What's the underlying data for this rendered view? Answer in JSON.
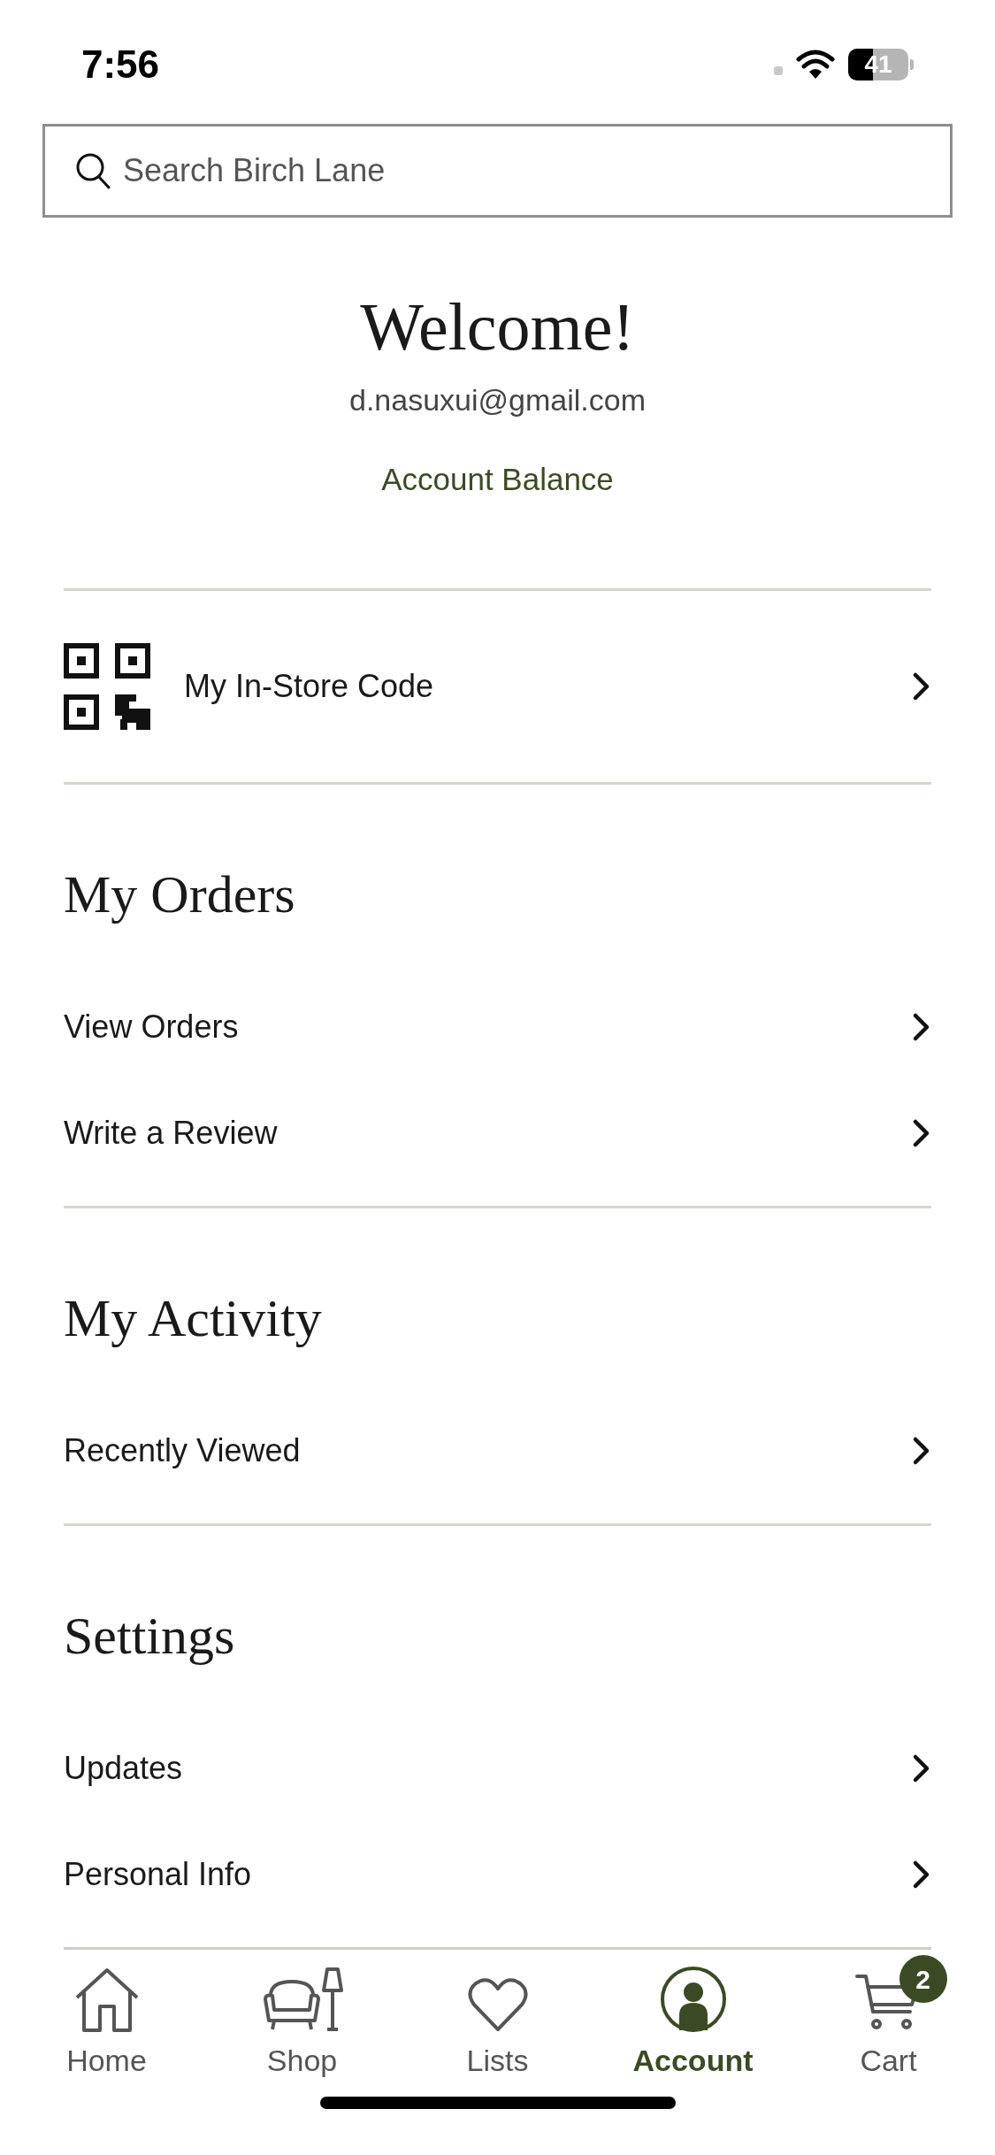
{
  "status_bar": {
    "time": "7:56",
    "battery": "41"
  },
  "search": {
    "placeholder": "Search Birch Lane"
  },
  "welcome": {
    "title": "Welcome!",
    "email": "d.nasuxui@gmail.com",
    "link": "Account Balance"
  },
  "store_code": {
    "label": "My In-Store Code"
  },
  "sections": [
    {
      "title": "My Orders",
      "items": [
        "View Orders",
        "Write a Review"
      ]
    },
    {
      "title": "My Activity",
      "items": [
        "Recently Viewed"
      ]
    },
    {
      "title": "Settings",
      "items": [
        "Updates",
        "Personal Info"
      ]
    }
  ],
  "tab_bar": [
    {
      "kind": "home",
      "label": "Home",
      "selected": false
    },
    {
      "kind": "shop",
      "label": "Shop",
      "selected": false
    },
    {
      "kind": "lists",
      "label": "Lists",
      "selected": false
    },
    {
      "kind": "account",
      "label": "Account",
      "selected": true
    },
    {
      "kind": "cart",
      "label": "Cart",
      "selected": false,
      "badge": "2"
    }
  ]
}
